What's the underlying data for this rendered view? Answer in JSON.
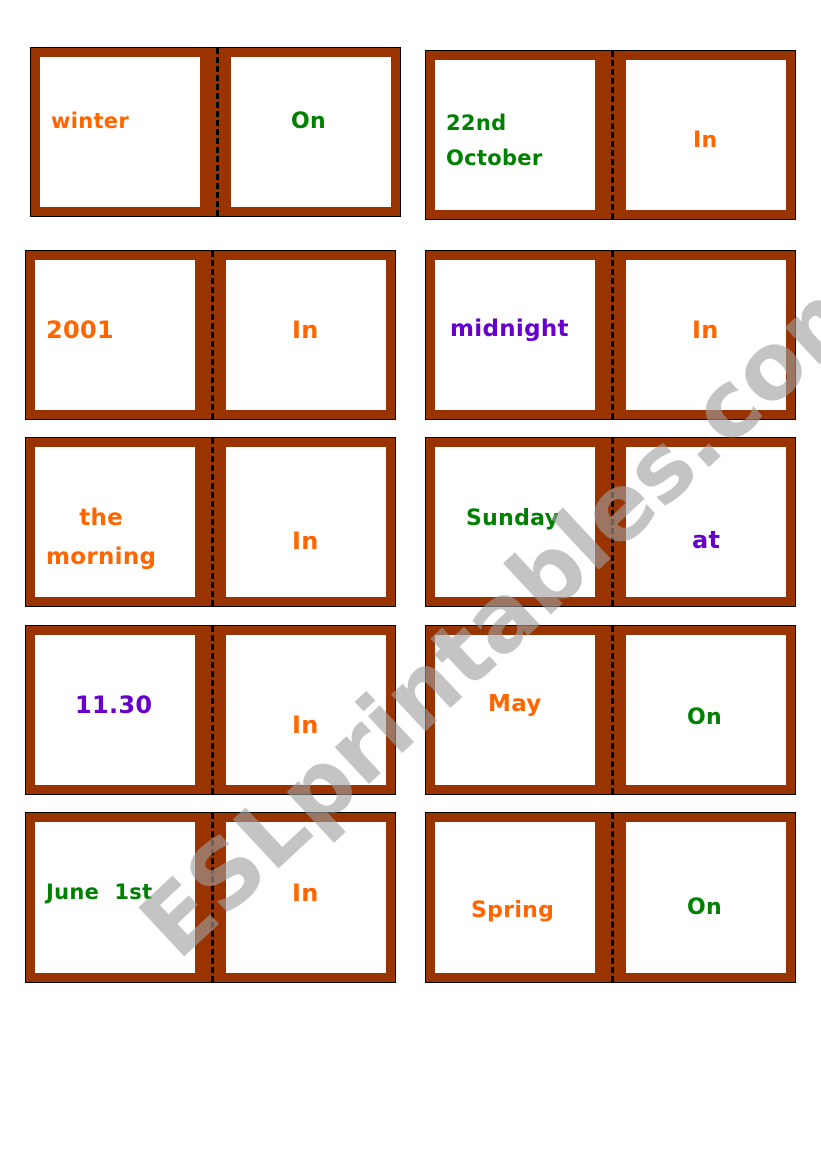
{
  "colors": {
    "domino_frame": "#993300",
    "orange": "#ff6600",
    "green": "#008000",
    "purple": "#6600cc"
  },
  "watermark": "ESLprintables.com",
  "dominoes": [
    {
      "left": {
        "text": "winter",
        "color": "orange"
      },
      "right": {
        "text": "On",
        "color": "green"
      }
    },
    {
      "left": {
        "text": "22nd\nOctober",
        "color": "green"
      },
      "right": {
        "text": "In",
        "color": "orange"
      }
    },
    {
      "left": {
        "text": "2001",
        "color": "orange"
      },
      "right": {
        "text": "In",
        "color": "orange"
      }
    },
    {
      "left": {
        "text": "midnight",
        "color": "purple"
      },
      "right": {
        "text": "In",
        "color": "orange"
      }
    },
    {
      "left": {
        "text": "the\nmorning",
        "color": "orange"
      },
      "right": {
        "text": "In",
        "color": "orange"
      }
    },
    {
      "left": {
        "text": "Sunday",
        "color": "green"
      },
      "right": {
        "text": "at",
        "color": "purple"
      }
    },
    {
      "left": {
        "text": "11.30",
        "color": "purple"
      },
      "right": {
        "text": "In",
        "color": "orange"
      }
    },
    {
      "left": {
        "text": "May",
        "color": "orange"
      },
      "right": {
        "text": "On",
        "color": "green"
      }
    },
    {
      "left": {
        "text": "June  1st",
        "color": "green"
      },
      "right": {
        "text": "In",
        "color": "orange"
      }
    },
    {
      "left": {
        "text": "Spring",
        "color": "orange"
      },
      "right": {
        "text": "On",
        "color": "green"
      }
    }
  ]
}
